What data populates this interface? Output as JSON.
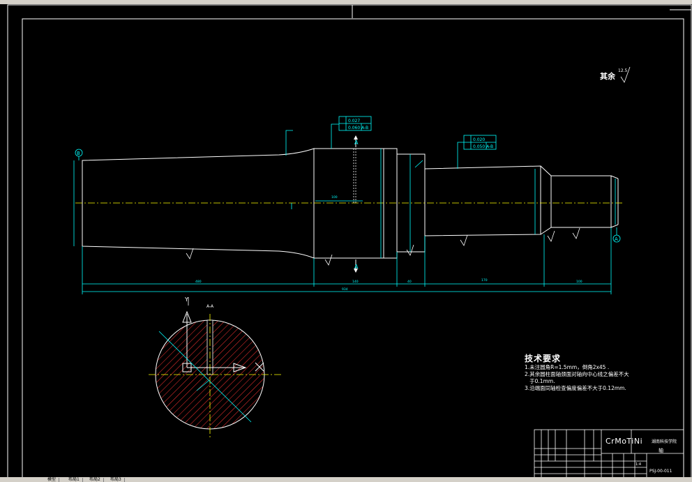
{
  "surface_finish": {
    "label": "其余",
    "value": "12.5"
  },
  "section_label": "A-A",
  "section_marks": {
    "upper": "A",
    "lower": "A"
  },
  "view_mark": "Y",
  "datum_marks": {
    "left": "B",
    "right": "A"
  },
  "tolerance_frames": [
    {
      "rows": [
        "0.027",
        "0.060 A-B"
      ]
    },
    {
      "rows": [
        "0.020",
        "0.050 A-B"
      ]
    }
  ],
  "tech_notes": {
    "title": "技术要求",
    "items": [
      "1.未注圆角R=1.5mm，倒角2x45 .",
      "2.其余圆柱面轴颈面对轴向中心线之偏差不大",
      "   于0.1mm.",
      "3.沿端面同轴检查偏度偏差不大于0.12mm."
    ]
  },
  "title_block": {
    "material": "CrMoTiNi",
    "school": "湖南科技学院",
    "part_name": "轴",
    "drawing_no": "PSJ-00-011",
    "scale": "1:4"
  },
  "layout_tabs": [
    "模型",
    "布局1",
    "布局2",
    "布局3"
  ],
  "colors": {
    "geometry": "#ffffff",
    "dimension": "#00ffff",
    "hatch": "#ff3333",
    "center": "#ffff00"
  }
}
